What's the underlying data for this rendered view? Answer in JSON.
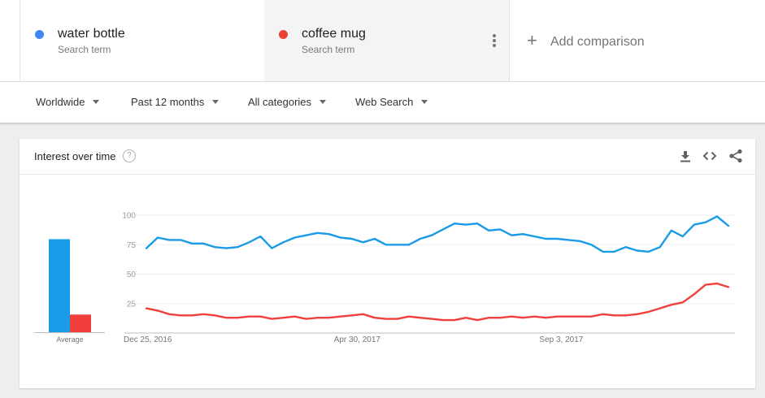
{
  "terms": [
    {
      "name": "water bottle",
      "sub": "Search term",
      "color": "#4285f4"
    },
    {
      "name": "coffee mug",
      "sub": "Search term",
      "color": "#ea4335"
    }
  ],
  "add_comparison": "Add comparison",
  "filters": [
    "Worldwide",
    "Past 12 months",
    "All categories",
    "Web Search"
  ],
  "card": {
    "title": "Interest over time",
    "help": "?"
  },
  "icons": [
    "more-vert-icon",
    "plus-icon",
    "caret-down-icon",
    "help-icon",
    "download-icon",
    "embed-code-icon",
    "share-icon"
  ],
  "chart_data": {
    "type": "line",
    "x_tick_labels": [
      "Dec 25, 2016",
      "Apr 30, 2017",
      "Sep 3, 2017"
    ],
    "y_ticks": [
      25,
      50,
      75,
      100
    ],
    "ylim": [
      0,
      100
    ],
    "grid": true,
    "average_label": "Average",
    "averages": [
      {
        "name": "water bottle",
        "value": 79,
        "color": "#1a9be8"
      },
      {
        "name": "coffee mug",
        "value": 15,
        "color": "#f1403c"
      }
    ],
    "series": [
      {
        "name": "water bottle",
        "color": "#1a9be8",
        "values": [
          72,
          81,
          79,
          79,
          76,
          76,
          73,
          72,
          73,
          77,
          82,
          72,
          77,
          81,
          83,
          85,
          84,
          81,
          80,
          77,
          80,
          75,
          75,
          75,
          80,
          83,
          88,
          93,
          92,
          93,
          87,
          88,
          83,
          84,
          82,
          80,
          80,
          79,
          78,
          75,
          69,
          69,
          73,
          70,
          69,
          73,
          87,
          82,
          92,
          94,
          99,
          91
        ]
      },
      {
        "name": "coffee mug",
        "color": "#f1403c",
        "values": [
          21,
          19,
          16,
          15,
          15,
          16,
          15,
          13,
          13,
          14,
          14,
          12,
          13,
          14,
          12,
          13,
          13,
          14,
          15,
          16,
          13,
          12,
          12,
          14,
          13,
          12,
          11,
          11,
          13,
          11,
          13,
          13,
          14,
          13,
          14,
          13,
          14,
          14,
          14,
          14,
          16,
          15,
          15,
          16,
          18,
          21,
          24,
          26,
          33,
          41,
          42,
          39
        ]
      }
    ]
  }
}
